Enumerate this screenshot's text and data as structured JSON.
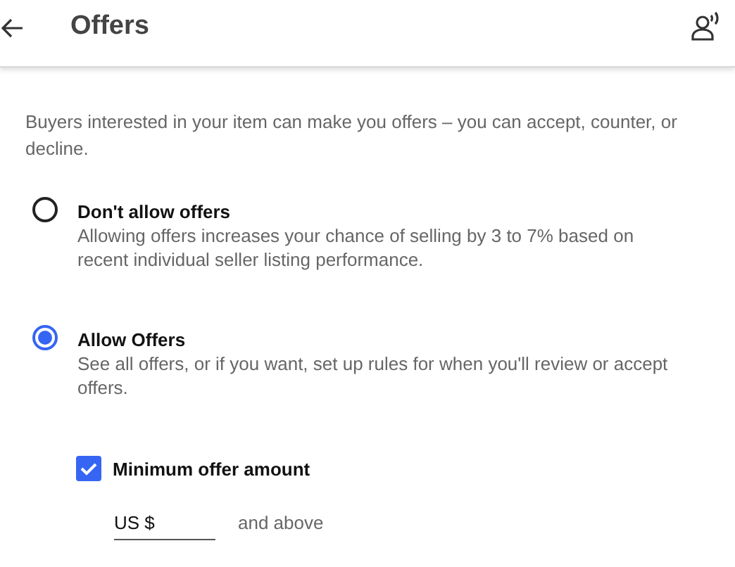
{
  "header": {
    "title": "Offers"
  },
  "intro": "Buyers interested in your item can make you offers – you can accept, counter, or decline.",
  "options": [
    {
      "label": "Don't allow offers",
      "description": "Allowing offers increases your chance of selling by 3 to 7% based on recent individual seller listing performance.",
      "selected": false
    },
    {
      "label": "Allow Offers",
      "description": "See all offers, or if you want, set up rules for when you'll review or accept offers.",
      "selected": true
    }
  ],
  "minimum_offer": {
    "label": "Minimum offer amount",
    "checked": true,
    "prefix": "US $",
    "suffix": "and above"
  }
}
